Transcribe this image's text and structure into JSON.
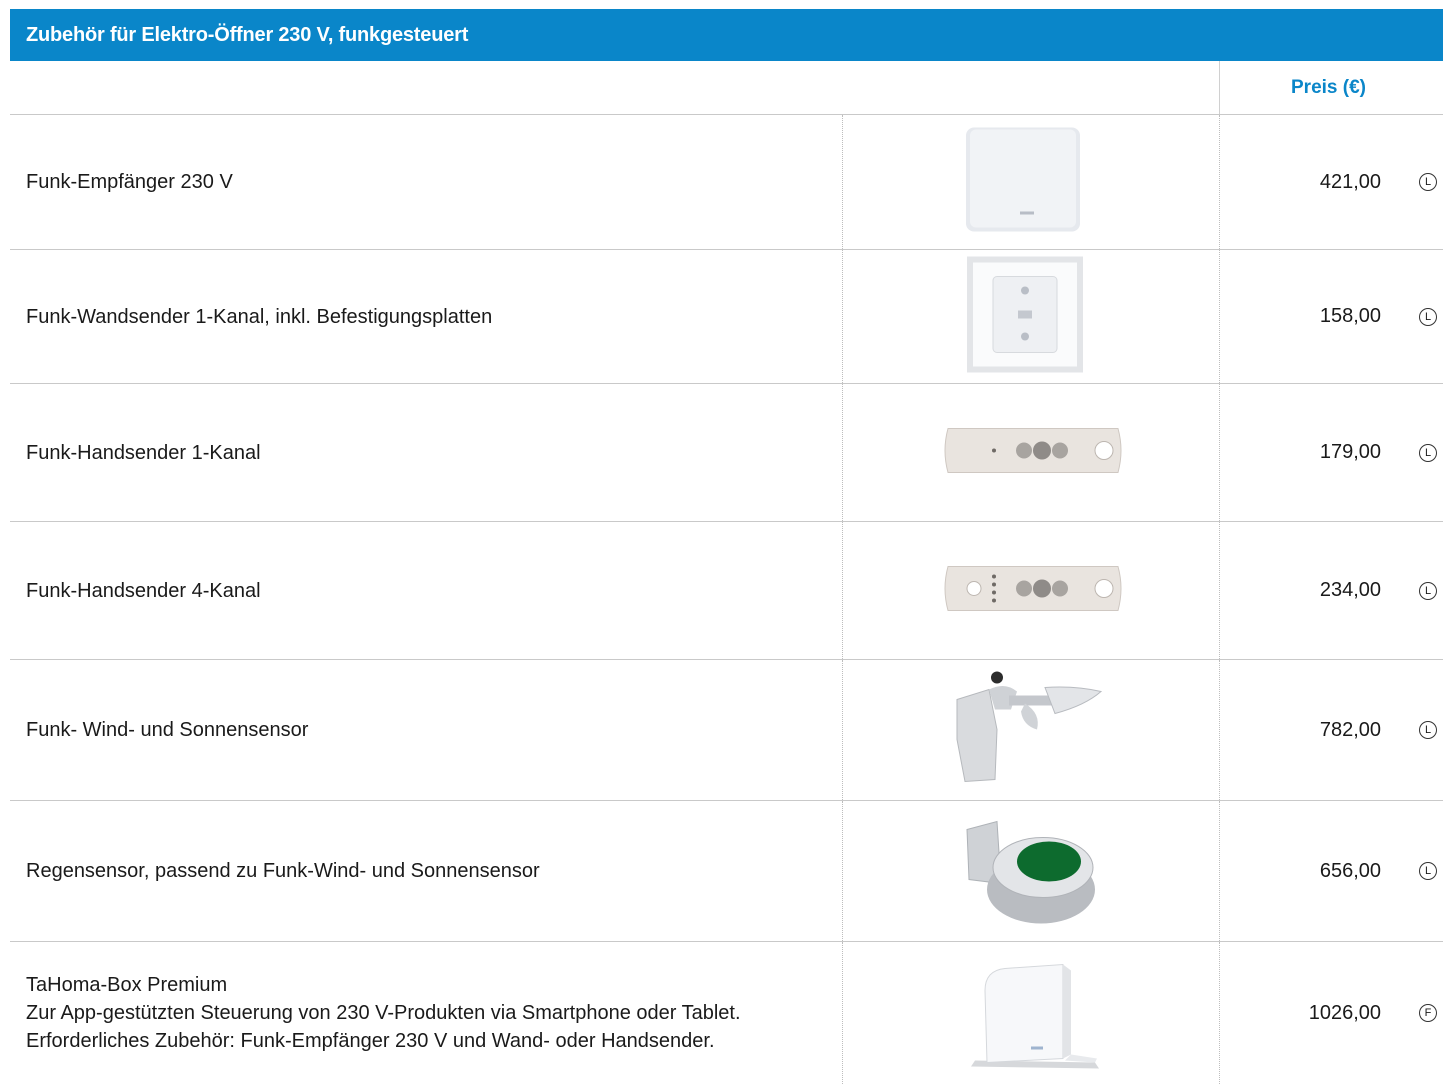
{
  "table": {
    "title": "Zubehör für Elektro-Öffner 230 V, funkgesteuert",
    "price_header": "Preis (€)",
    "rows": [
      {
        "lines": [
          "Funk-Empfänger 230 V"
        ],
        "price": "421,00",
        "code": "L",
        "image_icon": "receiver-box-icon"
      },
      {
        "lines": [
          "Funk-Wandsender 1-Kanal, inkl. Befestigungsplatten"
        ],
        "price": "158,00",
        "code": "L",
        "image_icon": "wall-switch-icon"
      },
      {
        "lines": [
          "Funk-Handsender 1-Kanal"
        ],
        "price": "179,00",
        "code": "L",
        "image_icon": "remote-1ch-icon"
      },
      {
        "lines": [
          "Funk-Handsender 4-Kanal"
        ],
        "price": "234,00",
        "code": "L",
        "image_icon": "remote-4ch-icon"
      },
      {
        "lines": [
          "Funk- Wind- und Sonnensensor"
        ],
        "price": "782,00",
        "code": "L",
        "image_icon": "wind-sensor-icon"
      },
      {
        "lines": [
          "Regensensor, passend zu Funk-Wind- und Sonnensensor"
        ],
        "price": "656,00",
        "code": "L",
        "image_icon": "rain-sensor-icon"
      },
      {
        "lines": [
          "TaHoma-Box Premium",
          "Zur App-gestützten Steuerung von 230 V-Produkten via Smartphone oder Tablet.",
          "Erforderliches Zubehör: Funk-Empfänger 230 V und Wand- oder Handsender."
        ],
        "price": "1026,00",
        "code": "F",
        "image_icon": "tahoma-box-icon"
      }
    ]
  },
  "colors": {
    "accent": "#0a86c9",
    "rule": "#c9c9c9"
  }
}
